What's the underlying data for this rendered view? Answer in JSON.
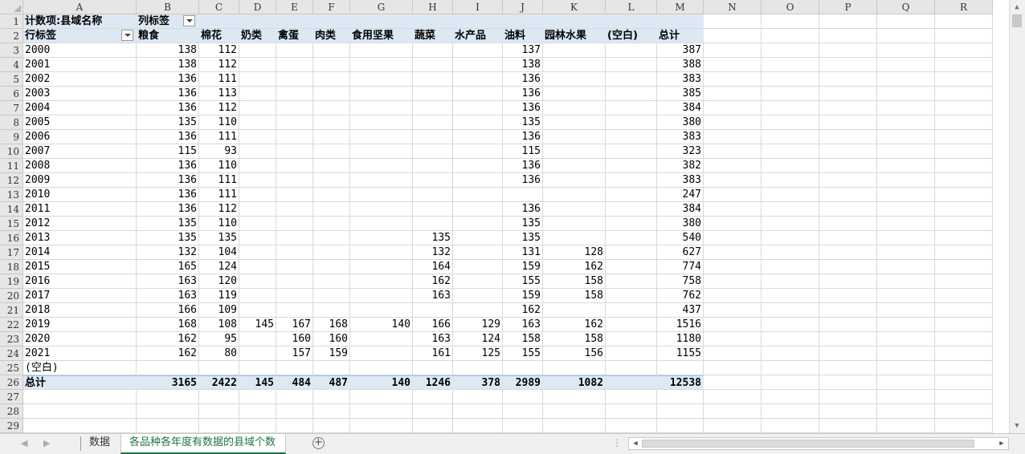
{
  "columns": [
    "A",
    "B",
    "C",
    "D",
    "E",
    "F",
    "G",
    "H",
    "I",
    "J",
    "K",
    "L",
    "M",
    "N",
    "O",
    "P",
    "Q",
    "R"
  ],
  "pivot": {
    "title": "计数项:县域名称",
    "col_label": "列标签",
    "row_label": "行标签",
    "headers": [
      "粮食",
      "棉花",
      "奶类",
      "禽蛋",
      "肉类",
      "食用坚果",
      "蔬菜",
      "水产品",
      "油料",
      "园林水果",
      "(空白)",
      "总计"
    ],
    "rows": [
      {
        "label": "2000",
        "values": [
          "138",
          "112",
          "",
          "",
          "",
          "",
          "",
          "",
          "137",
          "",
          "",
          "387"
        ]
      },
      {
        "label": "2001",
        "values": [
          "138",
          "112",
          "",
          "",
          "",
          "",
          "",
          "",
          "138",
          "",
          "",
          "388"
        ]
      },
      {
        "label": "2002",
        "values": [
          "136",
          "111",
          "",
          "",
          "",
          "",
          "",
          "",
          "136",
          "",
          "",
          "383"
        ]
      },
      {
        "label": "2003",
        "values": [
          "136",
          "113",
          "",
          "",
          "",
          "",
          "",
          "",
          "136",
          "",
          "",
          "385"
        ]
      },
      {
        "label": "2004",
        "values": [
          "136",
          "112",
          "",
          "",
          "",
          "",
          "",
          "",
          "136",
          "",
          "",
          "384"
        ]
      },
      {
        "label": "2005",
        "values": [
          "135",
          "110",
          "",
          "",
          "",
          "",
          "",
          "",
          "135",
          "",
          "",
          "380"
        ]
      },
      {
        "label": "2006",
        "values": [
          "136",
          "111",
          "",
          "",
          "",
          "",
          "",
          "",
          "136",
          "",
          "",
          "383"
        ]
      },
      {
        "label": "2007",
        "values": [
          "115",
          "93",
          "",
          "",
          "",
          "",
          "",
          "",
          "115",
          "",
          "",
          "323"
        ]
      },
      {
        "label": "2008",
        "values": [
          "136",
          "110",
          "",
          "",
          "",
          "",
          "",
          "",
          "136",
          "",
          "",
          "382"
        ]
      },
      {
        "label": "2009",
        "values": [
          "136",
          "111",
          "",
          "",
          "",
          "",
          "",
          "",
          "136",
          "",
          "",
          "383"
        ]
      },
      {
        "label": "2010",
        "values": [
          "136",
          "111",
          "",
          "",
          "",
          "",
          "",
          "",
          "",
          "",
          "",
          "247"
        ]
      },
      {
        "label": "2011",
        "values": [
          "136",
          "112",
          "",
          "",
          "",
          "",
          "",
          "",
          "136",
          "",
          "",
          "384"
        ]
      },
      {
        "label": "2012",
        "values": [
          "135",
          "110",
          "",
          "",
          "",
          "",
          "",
          "",
          "135",
          "",
          "",
          "380"
        ]
      },
      {
        "label": "2013",
        "values": [
          "135",
          "135",
          "",
          "",
          "",
          "",
          "135",
          "",
          "135",
          "",
          "",
          "540"
        ]
      },
      {
        "label": "2014",
        "values": [
          "132",
          "104",
          "",
          "",
          "",
          "",
          "132",
          "",
          "131",
          "128",
          "",
          "627"
        ]
      },
      {
        "label": "2015",
        "values": [
          "165",
          "124",
          "",
          "",
          "",
          "",
          "164",
          "",
          "159",
          "162",
          "",
          "774"
        ]
      },
      {
        "label": "2016",
        "values": [
          "163",
          "120",
          "",
          "",
          "",
          "",
          "162",
          "",
          "155",
          "158",
          "",
          "758"
        ]
      },
      {
        "label": "2017",
        "values": [
          "163",
          "119",
          "",
          "",
          "",
          "",
          "163",
          "",
          "159",
          "158",
          "",
          "762"
        ]
      },
      {
        "label": "2018",
        "values": [
          "166",
          "109",
          "",
          "",
          "",
          "",
          "",
          "",
          "162",
          "",
          "",
          "437"
        ]
      },
      {
        "label": "2019",
        "values": [
          "168",
          "108",
          "145",
          "167",
          "168",
          "140",
          "166",
          "129",
          "163",
          "162",
          "",
          "1516"
        ]
      },
      {
        "label": "2020",
        "values": [
          "162",
          "95",
          "",
          "160",
          "160",
          "",
          "163",
          "124",
          "158",
          "158",
          "",
          "1180"
        ]
      },
      {
        "label": "2021",
        "values": [
          "162",
          "80",
          "",
          "157",
          "159",
          "",
          "161",
          "125",
          "155",
          "156",
          "",
          "1155"
        ]
      },
      {
        "label": "(空白)",
        "values": [
          "",
          "",
          "",
          "",
          "",
          "",
          "",
          "",
          "",
          "",
          "",
          ""
        ]
      }
    ],
    "total": {
      "label": "总计",
      "values": [
        "3165",
        "2422",
        "145",
        "484",
        "487",
        "140",
        "1246",
        "378",
        "2989",
        "1082",
        "",
        "12538"
      ]
    }
  },
  "tabs": [
    {
      "label": "数据",
      "active": false
    },
    {
      "label": "各品种各年度有数据的县域个数",
      "active": true
    }
  ],
  "icons": {
    "add_sheet": "plus-circle-icon",
    "filter": "dropdown-filter-icon"
  },
  "colors": {
    "pivot_header": "#dce9f5",
    "active_tab": "#217346",
    "grid": "#d9d9d9"
  }
}
